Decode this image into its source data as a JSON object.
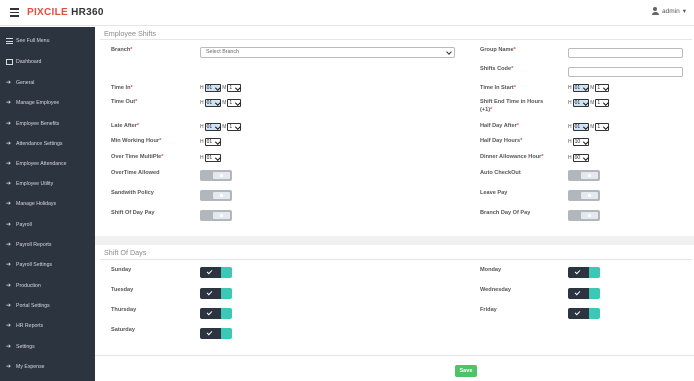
{
  "header": {
    "brand_1": "PIXCILE",
    "brand_2": "HR360",
    "user": "admin",
    "user_caret": "▾"
  },
  "sidebar": {
    "items": [
      {
        "label": "See Full Menu",
        "icon": "list-icon"
      },
      {
        "label": "Dashboard",
        "icon": "monitor-icon"
      },
      {
        "label": "General",
        "icon": "arrow-right-icon"
      },
      {
        "label": "Manage Employee",
        "icon": "arrow-right-icon"
      },
      {
        "label": "Employee Benefits",
        "icon": "arrow-right-icon"
      },
      {
        "label": "Attendance Settings",
        "icon": "arrow-right-icon"
      },
      {
        "label": "Employee Attendance",
        "icon": "arrow-right-icon"
      },
      {
        "label": "Employee Utility",
        "icon": "arrow-right-icon"
      },
      {
        "label": "Manage Holidays",
        "icon": "arrow-right-icon"
      },
      {
        "label": "Payroll",
        "icon": "arrow-right-icon"
      },
      {
        "label": "Payroll Reports",
        "icon": "arrow-right-icon"
      },
      {
        "label": "Payroll Settings",
        "icon": "arrow-right-icon"
      },
      {
        "label": "Production",
        "icon": "arrow-right-icon"
      },
      {
        "label": "Portal Settings",
        "icon": "arrow-right-icon"
      },
      {
        "label": "HR Reports",
        "icon": "arrow-right-icon"
      },
      {
        "label": "Settings",
        "icon": "arrow-right-icon"
      },
      {
        "label": "My Expense",
        "icon": "arrow-right-icon"
      }
    ]
  },
  "shifts": {
    "title": "Employee Shifts",
    "branch_label": "Branch",
    "branch_placeholder": "Select Branch",
    "group_name_label": "Group Name",
    "shifts_code_label": "Shifts Code",
    "time_in_label": "Time In",
    "time_out_label": "Time Out",
    "late_after_label": "Late After",
    "min_working_label": "Min Working Hour",
    "overtime_multiple_label": "Over Time MultiPle",
    "overtime_allowed_label": "OverTime Allowed",
    "sandwith_label": "Sandwith Policy",
    "shift_off_day_label": "Shift Of Day Pay",
    "time_in_start_label": "Time In Start",
    "shift_end_time_label": "Shift End Time in Hours",
    "shift_end_time_note": "(+1)",
    "half_day_after_label": "Half Day After",
    "half_day_hours_label": "Half Day Hours",
    "dinner_allowance_label": "Dinner Allowance Hour",
    "auto_checkout_label": "Auto CheckOut",
    "leave_pay_label": "Leave Pay",
    "branch_day_off_label": "Branch Day Of Pay",
    "req_mark": "*",
    "h_prefix": "H",
    "m_prefix": "M",
    "hour_default": "01",
    "min_default": "1",
    "hour_10": "10",
    "hour_00": "00"
  },
  "days": {
    "title": "Shift Of Days",
    "sunday": "Sunday",
    "monday": "Monday",
    "tuesday": "Tuesday",
    "wednesday": "Wednesday",
    "thursday": "Thursday",
    "friday": "Friday",
    "saturday": "Saturday"
  },
  "actions": {
    "save_label": "Save"
  },
  "colors": {
    "brand_red": "#e84c3d",
    "sidebar_bg": "#2c3440",
    "teal": "#3cc8b4",
    "save_green": "#4cc467"
  }
}
